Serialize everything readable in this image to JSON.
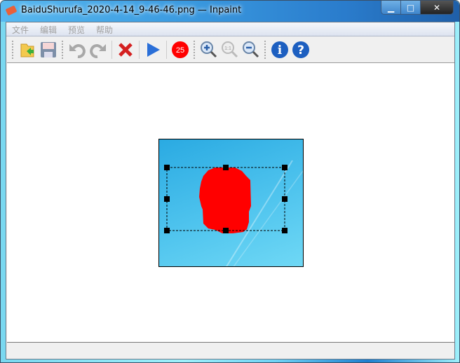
{
  "window": {
    "title": "BaiduShurufa_2020-4-14_9-46-46.png — Inpaint",
    "minimize": "▁",
    "maximize": "□",
    "close": "✕"
  },
  "menu": [
    "文件",
    "编辑",
    "预览",
    "帮助"
  ],
  "toolbar": {
    "brush_size": "25",
    "items": [
      "open-icon",
      "save-icon",
      "undo-icon",
      "redo-icon",
      "delete-icon",
      "run-icon",
      "brush-size",
      "zoom-in-icon",
      "zoom-actual-icon",
      "zoom-out-icon",
      "info-icon",
      "help-icon"
    ],
    "zoom_actual_label": "1:1",
    "info_label": "i",
    "help_label": "?"
  },
  "colors": {
    "mask": "#ff0000",
    "title_bar": "#2a7ccc"
  }
}
